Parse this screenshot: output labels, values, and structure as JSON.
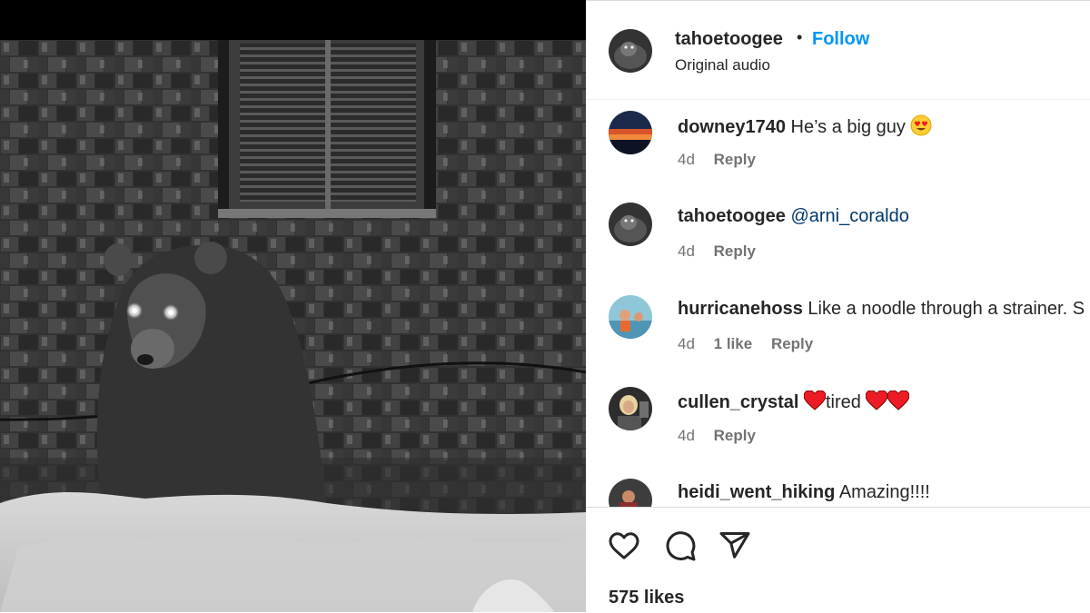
{
  "post": {
    "owner": "tahoetoogee",
    "separator": "•",
    "follow_label": "Follow",
    "audio": "Original audio"
  },
  "comments": [
    {
      "user": "downey1740",
      "text": "He’s a big guy",
      "emoji": "smiling-face-with-heart-eyes",
      "time": "4d",
      "reply": "Reply"
    },
    {
      "user": "tahoetoogee",
      "mention": "@arni_coraldo",
      "time": "4d",
      "reply": "Reply"
    },
    {
      "user": "hurricanehoss",
      "text": "Like a noodle through a strainer. S",
      "time": "4d",
      "likes": "1 like",
      "reply": "Reply"
    },
    {
      "user": "cullen_crystal",
      "text": "tired",
      "emoji": "red-heart",
      "time": "4d",
      "reply": "Reply"
    },
    {
      "user": "heidi_went_hiking",
      "text": "Amazing!!!!"
    }
  ],
  "actions": {
    "icons": [
      "heart-icon",
      "comment-icon",
      "share-icon"
    ],
    "likes": "575 likes"
  },
  "colors": {
    "accent": "#0095f6",
    "mention": "#00376b",
    "heart": "#ed1c24"
  }
}
